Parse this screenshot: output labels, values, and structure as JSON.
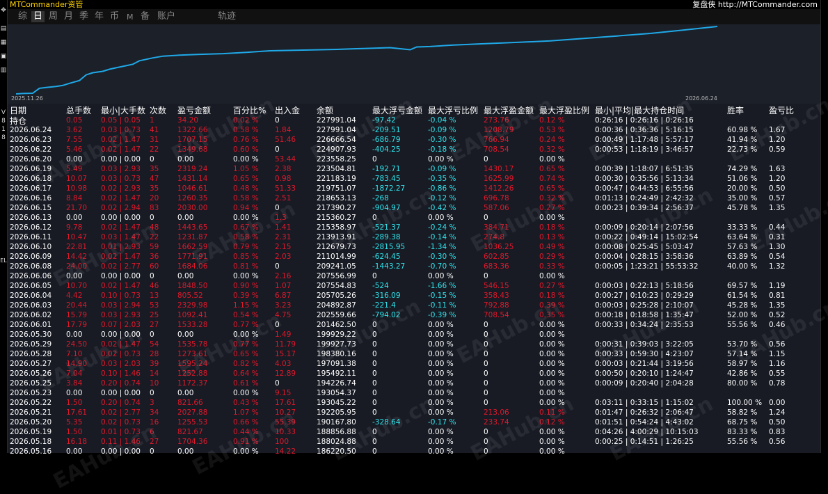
{
  "app": {
    "title": "MTCommander资管",
    "link": "复盘侠 http://MTCommander.com"
  },
  "tabs": [
    "综",
    "日",
    "周",
    "月",
    "季",
    "年",
    "币",
    "M",
    "备",
    "账户",
    "轨迹"
  ],
  "active_tab": "日",
  "left_frame_ticks": [
    "V",
    "8",
    "1",
    "8",
    "EL"
  ],
  "chart": {
    "start_label": "2025.11.26",
    "end_label": "2026.06.24",
    "line_color": "#1fa9e8",
    "x": [
      "2025.11.26",
      "2025.11.28",
      "2025.12.01",
      "2025.12.03",
      "2025.12.05",
      "2025.12.08",
      "2025.12.10",
      "2025.12.12",
      "2025.12.15",
      "2025.12.17",
      "2025.12.19",
      "2025.12.22",
      "2025.12.24",
      "2025.12.26",
      "2025.12.29",
      "2025.12.31",
      "2026.01.02",
      "2026.01.06",
      "2026.01.09",
      "2026.01.14",
      "2026.01.20",
      "2026.01.27",
      "2026.02.03",
      "2026.02.10",
      "2026.02.20",
      "2026.03.02",
      "2026.03.10",
      "2026.03.18",
      "2026.03.24",
      "2026.03.26",
      "2026.03.30",
      "2026.04.06",
      "2026.04.15",
      "2026.04.25",
      "2026.05.05",
      "2026.05.15",
      "2026.05.25",
      "2026.06.04",
      "2026.06.14",
      "2026.06.24"
    ],
    "y": [
      100000,
      100600,
      101000,
      108000,
      109200,
      110500,
      112000,
      115000,
      119000,
      127000,
      130000,
      132000,
      135000,
      137000,
      140000,
      142000,
      147000,
      151000,
      153500,
      154800,
      156000,
      157000,
      158800,
      161000,
      162000,
      163000,
      164300,
      165500,
      162500,
      166500,
      167000,
      169200,
      171000,
      173000,
      175000,
      178600,
      182000,
      185700,
      190500,
      195500
    ]
  },
  "table": {
    "headers": [
      "日期",
      "总手数",
      "最小|大手数",
      "次数",
      "盈亏金额",
      "百分比%",
      "出入金",
      "余额",
      "最大浮亏金额",
      "最大浮亏比例",
      "最大浮盈金额",
      "最大浮盈比例",
      "最小|平均|最大持仓时间",
      "胜率",
      "盈亏比"
    ],
    "subheader": "持仓",
    "rows": [
      {
        "date": "2026.06.24",
        "lot": "3.62",
        "mm": "0.03 | 0.73",
        "cnt": "41",
        "pl": "1322.66",
        "pct": "0.58 %",
        "io": "1.84",
        "bal": "227991.04",
        "fla": "-209.51",
        "flp": "-0.09 %",
        "fga": "1208.79",
        "fgp": "0.53 %",
        "time": "0:00:36 | 0:36:36 | 5:16:15",
        "win": "60.98 %",
        "pr": "1.67"
      },
      {
        "date": "2026.06.23",
        "lot": "7.55",
        "mm": "0.02 | 1.47",
        "cnt": "31",
        "pl": "1707.15",
        "pct": "0.76 %",
        "io": "51.46",
        "bal": "226666.54",
        "fla": "-686.79",
        "flp": "-0.30 %",
        "fga": "766.94",
        "fgp": "0.24 %",
        "time": "0:00:49 | 1:17:48 | 5:57:17",
        "win": "41.94 %",
        "pr": "1.20"
      },
      {
        "date": "2026.06.22",
        "lot": "5.46",
        "mm": "0.02 | 1.47",
        "cnt": "22",
        "pl": "1349.68",
        "pct": "0.60 %",
        "io": "0",
        "bal": "224907.93",
        "fla": "-404.25",
        "flp": "-0.18 %",
        "fga": "708.54",
        "fgp": "0.32 %",
        "time": "0:00:53 | 1:18:19 | 3:46:57",
        "win": "22.73 %",
        "pr": "0.59"
      },
      {
        "date": "2026.06.20",
        "lot": "0.00",
        "mm": "0.00 | 0.00",
        "cnt": "0",
        "pl": "0.00",
        "pct": "0.00 %",
        "io": "53.44",
        "bal": "223558.25",
        "fla": "0",
        "flp": "0.00 %",
        "fga": "0",
        "fgp": "0.00 %",
        "time": "",
        "win": "",
        "pr": ""
      },
      {
        "date": "2026.06.19",
        "lot": "5.49",
        "mm": "0.03 | 2.93",
        "cnt": "35",
        "pl": "2319.24",
        "pct": "1.05 %",
        "io": "2.38",
        "bal": "223504.81",
        "fla": "-192.71",
        "flp": "-0.09 %",
        "fga": "1430.17",
        "fgp": "0.65 %",
        "time": "0:00:39 | 1:18:07 | 6:51:35",
        "win": "74.29 %",
        "pr": "1.63"
      },
      {
        "date": "2026.06.18",
        "lot": "10.07",
        "mm": "0.03 | 0.73",
        "cnt": "47",
        "pl": "1431.14",
        "pct": "0.65 %",
        "io": "0.98",
        "bal": "221183.19",
        "fla": "-783.45",
        "flp": "-0.35 %",
        "fga": "1625.99",
        "fgp": "0.74 %",
        "time": "0:00:30 | 0:35:56 | 5:13:34",
        "win": "51.06 %",
        "pr": "1.20"
      },
      {
        "date": "2026.06.17",
        "lot": "10.98",
        "mm": "0.02 | 2.93",
        "cnt": "35",
        "pl": "1046.61",
        "pct": "0.48 %",
        "io": "51.33",
        "bal": "219751.07",
        "fla": "-1872.27",
        "flp": "-0.86 %",
        "fga": "1412.26",
        "fgp": "0.65 %",
        "time": "0:00:47 | 0:44:53 | 6:55:56",
        "win": "20.00 %",
        "pr": "0.50"
      },
      {
        "date": "2026.06.16",
        "lot": "8.84",
        "mm": "0.02 | 1.47",
        "cnt": "20",
        "pl": "1260.35",
        "pct": "0.58 %",
        "io": "2.51",
        "bal": "218653.13",
        "fla": "-268",
        "flp": "-0.12 %",
        "fga": "696.78",
        "fgp": "0.32 %",
        "time": "0:01:13 | 0:24:49 | 2:42:32",
        "win": "35.00 %",
        "pr": "0.57"
      },
      {
        "date": "2026.06.15",
        "lot": "21.70",
        "mm": "0.02 | 2.94",
        "cnt": "83",
        "pl": "2030.00",
        "pct": "0.94 %",
        "io": "0",
        "bal": "217390.27",
        "fla": "-904.97",
        "flp": "-0.42 %",
        "fga": "587.06",
        "fgp": "0.27 %",
        "time": "0:00:23 | 0:39:34 | 2:56:37",
        "win": "45.78 %",
        "pr": "1.35"
      },
      {
        "date": "2026.06.13",
        "lot": "0.00",
        "mm": "0.00 | 0.00",
        "cnt": "0",
        "pl": "0.00",
        "pct": "0.00 %",
        "io": "1.3",
        "bal": "215360.27",
        "fla": "0",
        "flp": "0.00 %",
        "fga": "0",
        "fgp": "0.00 %",
        "time": "",
        "win": "",
        "pr": ""
      },
      {
        "date": "2026.06.12",
        "lot": "9.78",
        "mm": "0.02 | 1.47",
        "cnt": "48",
        "pl": "1443.65",
        "pct": "0.67 %",
        "io": "1.41",
        "bal": "215358.97",
        "fla": "-521.37",
        "flp": "-0.24 %",
        "fga": "384.71",
        "fgp": "0.18 %",
        "time": "0:00:09 | 0:20:14 | 2:07:56",
        "win": "33.33 %",
        "pr": "0.44"
      },
      {
        "date": "2026.06.11",
        "lot": "10.47",
        "mm": "0.03 | 1.47",
        "cnt": "22",
        "pl": "1231.87",
        "pct": "0.58 %",
        "io": "2.31",
        "bal": "213913.91",
        "fla": "-289.38",
        "flp": "-0.14 %",
        "fga": "274.8",
        "fgp": "0.13 %",
        "time": "0:00:22 | 0:49:14 | 15:02:54",
        "win": "63.64 %",
        "pr": "0.31"
      },
      {
        "date": "2026.06.10",
        "lot": "22.81",
        "mm": "0.01 | 2.93",
        "cnt": "59",
        "pl": "1662.59",
        "pct": "0.79 %",
        "io": "2.15",
        "bal": "212679.73",
        "fla": "-2815.95",
        "flp": "-1.34 %",
        "fga": "1036.25",
        "fgp": "0.49 %",
        "time": "0:00:08 | 0:25:45 | 5:03:47",
        "win": "57.63 %",
        "pr": "1.30"
      },
      {
        "date": "2026.06.09",
        "lot": "14.42",
        "mm": "0.02 | 1.47",
        "cnt": "36",
        "pl": "1771.91",
        "pct": "0.85 %",
        "io": "2.03",
        "bal": "211014.99",
        "fla": "-624.45",
        "flp": "-0.30 %",
        "fga": "602.85",
        "fgp": "0.29 %",
        "time": "0:00:04 | 0:28:15 | 3:58:36",
        "win": "63.89 %",
        "pr": "0.54"
      },
      {
        "date": "2026.06.08",
        "lot": "24.00",
        "mm": "0.02 | 2.77",
        "cnt": "60",
        "pl": "1684.06",
        "pct": "0.81 %",
        "io": "0",
        "bal": "209241.05",
        "fla": "-1443.27",
        "flp": "-0.70 %",
        "fga": "683.36",
        "fgp": "0.33 %",
        "time": "0:00:05 | 1:23:21 | 55:53:32",
        "win": "40.00 %",
        "pr": "1.32"
      },
      {
        "date": "2026.06.06",
        "lot": "0.00",
        "mm": "0.00 | 0.00",
        "cnt": "0",
        "pl": "0.00",
        "pct": "0.00 %",
        "io": "2.16",
        "bal": "207556.99",
        "fla": "0",
        "flp": "0.00 %",
        "fga": "0",
        "fgp": "0.00 %",
        "time": "",
        "win": "",
        "pr": ""
      },
      {
        "date": "2026.06.05",
        "lot": "10.70",
        "mm": "0.02 | 1.47",
        "cnt": "46",
        "pl": "1848.50",
        "pct": "0.90 %",
        "io": "1.07",
        "bal": "207554.83",
        "fla": "-524",
        "flp": "-1.66 %",
        "fga": "546.15",
        "fgp": "0.27 %",
        "time": "0:00:03 | 0:22:13 | 5:18:56",
        "win": "69.57 %",
        "pr": "1.19"
      },
      {
        "date": "2026.06.04",
        "lot": "4.42",
        "mm": "0.10 | 0.73",
        "cnt": "13",
        "pl": "805.52",
        "pct": "0.39 %",
        "io": "6.87",
        "bal": "205705.26",
        "fla": "-316.09",
        "flp": "-0.15 %",
        "fga": "358.43",
        "fgp": "0.18 %",
        "time": "0:00:27 | 0:10:23 | 0:29:29",
        "win": "61.54 %",
        "pr": "0.81"
      },
      {
        "date": "2026.06.03",
        "lot": "20.44",
        "mm": "0.03 | 2.94",
        "cnt": "53",
        "pl": "2329.98",
        "pct": "1.15 %",
        "io": "3.23",
        "bal": "204892.87",
        "fla": "-221.4",
        "flp": "-0.11 %",
        "fga": "792.88",
        "fgp": "0.39 %",
        "time": "0:00:03 | 0:25:28 | 2:10:07",
        "win": "45.28 %",
        "pr": "1.35"
      },
      {
        "date": "2026.06.02",
        "lot": "15.79",
        "mm": "0.03 | 2.93",
        "cnt": "25",
        "pl": "1092.41",
        "pct": "0.54 %",
        "io": "4.75",
        "bal": "202559.66",
        "fla": "-794.02",
        "flp": "-0.39 %",
        "fga": "708.54",
        "fgp": "0.35 %",
        "time": "0:00:18 | 0:18:58 | 1:35:47",
        "win": "52.00 %",
        "pr": "0.52"
      },
      {
        "date": "2026.06.01",
        "lot": "17.79",
        "mm": "0.07 | 2.03",
        "cnt": "27",
        "pl": "1533.28",
        "pct": "0.77 %",
        "io": "0",
        "bal": "201462.50",
        "fla": "0",
        "flp": "0.00 %",
        "fga": "0",
        "fgp": "0.00 %",
        "time": "0:00:33 | 0:34:24 | 2:35:53",
        "win": "55.56 %",
        "pr": "0.46"
      },
      {
        "date": "2026.05.30",
        "lot": "0.00",
        "mm": "0.00 | 0.00",
        "cnt": "0",
        "pl": "0.00",
        "pct": "0.00 %",
        "io": "1.49",
        "bal": "199929.22",
        "fla": "0",
        "flp": "0.00 %",
        "fga": "0",
        "fgp": "0.00 %",
        "time": "",
        "win": "",
        "pr": ""
      },
      {
        "date": "2026.05.29",
        "lot": "24.50",
        "mm": "0.02 | 1.47",
        "cnt": "54",
        "pl": "1535.78",
        "pct": "0.77 %",
        "io": "11.79",
        "bal": "199927.73",
        "fla": "0",
        "flp": "0.00 %",
        "fga": "0",
        "fgp": "0.00 %",
        "time": "0:00:31 | 0:39:03 | 3:22:05",
        "win": "53.70 %",
        "pr": "0.56"
      },
      {
        "date": "2026.05.28",
        "lot": "7.10",
        "mm": "0.02 | 0.73",
        "cnt": "28",
        "pl": "1273.61",
        "pct": "0.65 %",
        "io": "15.17",
        "bal": "198380.16",
        "fla": "0",
        "flp": "0.00 %",
        "fga": "0",
        "fgp": "0.00 %",
        "time": "0:00:33 | 0:59:30 | 4:23:07",
        "win": "57.14 %",
        "pr": "1.15"
      },
      {
        "date": "2026.05.27",
        "lot": "14.90",
        "mm": "0.03 | 2.03",
        "cnt": "39",
        "pl": "1595.24",
        "pct": "0.82 %",
        "io": "4.03",
        "bal": "197091.38",
        "fla": "0",
        "flp": "0.00 %",
        "fga": "0",
        "fgp": "0.00 %",
        "time": "0:00:03 | 0:21:44 | 3:19:56",
        "win": "58.97 %",
        "pr": "1.16"
      },
      {
        "date": "2026.05.26",
        "lot": "7.04",
        "mm": "0.10 | 1.46",
        "cnt": "14",
        "pl": "1252.88",
        "pct": "0.64 %",
        "io": "12.89",
        "bal": "195492.11",
        "fla": "0",
        "flp": "0.00 %",
        "fga": "0",
        "fgp": "0.00 %",
        "time": "0:00:50 | 0:20:10 | 1:24:47",
        "win": "42.86 %",
        "pr": "0.55"
      },
      {
        "date": "2026.05.25",
        "lot": "3.84",
        "mm": "0.20 | 0.74",
        "cnt": "10",
        "pl": "1172.37",
        "pct": "0.61 %",
        "io": "0",
        "bal": "194226.74",
        "fla": "0",
        "flp": "0.00 %",
        "fga": "0",
        "fgp": "0.00 %",
        "time": "0:00:09 | 0:20:40 | 2:04:28",
        "win": "80.00 %",
        "pr": "0.78"
      },
      {
        "date": "2026.05.23",
        "lot": "0.00",
        "mm": "0.00 | 0.00",
        "cnt": "0",
        "pl": "0.00",
        "pct": "0.00 %",
        "io": "9.15",
        "bal": "193054.37",
        "fla": "0",
        "flp": "0.00 %",
        "fga": "0",
        "fgp": "0.00 %",
        "time": "",
        "win": "",
        "pr": ""
      },
      {
        "date": "2026.05.22",
        "lot": "1.50",
        "mm": "0.20 | 0.74",
        "cnt": "3",
        "pl": "821.66",
        "pct": "0.43 %",
        "io": "17.61",
        "bal": "193045.22",
        "fla": "0",
        "flp": "0.00 %",
        "fga": "0",
        "fgp": "0.00 %",
        "time": "0:03:11 | 0:33:15 | 1:15:02",
        "win": "100.00 %",
        "pr": "0.00"
      },
      {
        "date": "2026.05.21",
        "lot": "17.61",
        "mm": "0.02 | 2.77",
        "cnt": "34",
        "pl": "2027.88",
        "pct": "1.07 %",
        "io": "10.27",
        "bal": "192205.95",
        "fla": "0",
        "flp": "0.00 %",
        "fga": "213.06",
        "fgp": "0.11 %",
        "time": "0:01:47 | 0:26:32 | 2:06:47",
        "win": "58.82 %",
        "pr": "1.24"
      },
      {
        "date": "2026.05.20",
        "lot": "5.35",
        "mm": "0.02 | 0.73",
        "cnt": "16",
        "pl": "1255.53",
        "pct": "0.66 %",
        "io": "55.39",
        "bal": "190167.80",
        "fla": "-328.64",
        "flp": "-0.17 %",
        "fga": "233.74",
        "fgp": "0.12 %",
        "time": "0:01:51 | 0:54:24 | 4:43:02",
        "win": "68.75 %",
        "pr": "0.50"
      },
      {
        "date": "2026.05.19",
        "lot": "1.50",
        "mm": "0.01 | 0.73",
        "cnt": "6",
        "pl": "821.67",
        "pct": "0.44 %",
        "io": "10.33",
        "bal": "188856.88",
        "fla": "0",
        "flp": "0.00 %",
        "fga": "0",
        "fgp": "0.00 %",
        "time": "0:04:26 | 4:00:29 | 10:15:03",
        "win": "83.33 %",
        "pr": "0.83"
      },
      {
        "date": "2026.05.18",
        "lot": "16.18",
        "mm": "0.11 | 1.46",
        "cnt": "27",
        "pl": "1704.36",
        "pct": "0.91 %",
        "io": "100",
        "bal": "188024.88",
        "fla": "0",
        "flp": "0.00 %",
        "fga": "0",
        "fgp": "0.00 %",
        "time": "0:00:25 | 0:14:51 | 1:26:25",
        "win": "55.56 %",
        "pr": "0.56"
      },
      {
        "date": "2026.05.16",
        "lot": "0.00",
        "mm": "0.00 | 0.00",
        "cnt": "0",
        "pl": "0.00",
        "pct": "0.00 %",
        "io": "14.22",
        "bal": "186220.50",
        "fla": "0",
        "flp": "0.00 %",
        "fga": "0",
        "fgp": "0.00 %",
        "time": "",
        "win": "",
        "pr": ""
      }
    ]
  },
  "open_position": {
    "lot": "0.05",
    "mm": "0.05 | 0.05",
    "cnt": "1",
    "pl": "34.20",
    "pct": "0.02 %",
    "io": "0",
    "bal": "227991.04",
    "fla": "-97.42",
    "flp": "-0.04 %",
    "fga": "273.76",
    "fgp": "0.12 %",
    "time": "0:26:16 | 0:26:16 | 0:26:16"
  },
  "watermark": "EAHub.cn"
}
